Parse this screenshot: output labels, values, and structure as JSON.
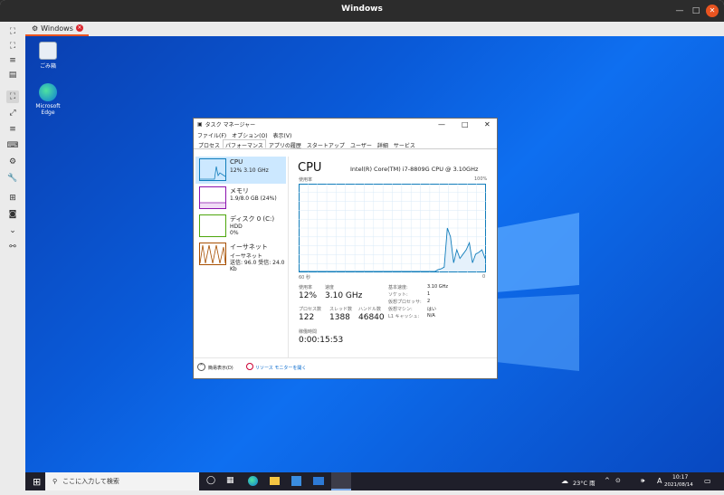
{
  "window": {
    "title": "Windows"
  },
  "tab": {
    "label": "Windows"
  },
  "desktop": {
    "icons": [
      {
        "label": "ごみ箱"
      },
      {
        "label": "Microsoft Edge"
      }
    ]
  },
  "taskmgr": {
    "title": "タスク マネージャー",
    "menus": [
      "ファイル(F)",
      "オプション(O)",
      "表示(V)"
    ],
    "tabs": [
      "プロセス",
      "パフォーマンス",
      "アプリの履歴",
      "スタートアップ",
      "ユーザー",
      "詳細",
      "サービス"
    ],
    "resources": [
      {
        "name": "CPU",
        "sub": "12%  3.10 GHz",
        "sub2": ""
      },
      {
        "name": "メモリ",
        "sub": "1.9/8.0 GB (24%)",
        "sub2": ""
      },
      {
        "name": "ディスク 0 (C:)",
        "sub": "HDD",
        "sub2": "0%"
      },
      {
        "name": "イーサネット",
        "sub": "イーサネット",
        "sub2": "送信: 96.0  受信: 24.0 Kb"
      }
    ],
    "cpu": {
      "heading": "CPU",
      "model": "Intel(R) Core(TM) i7-8809G CPU @ 3.10GHz",
      "graph_label": "使用率",
      "graph_max": "100%",
      "graph_time": "60 秒",
      "graph_zero": "0",
      "usage_label": "使用率",
      "usage": "12%",
      "speed_label": "速度",
      "speed": "3.10 GHz",
      "proc_label": "プロセス数",
      "proc": "122",
      "thread_label": "スレッド数",
      "thread": "1388",
      "handle_label": "ハンドル数",
      "handle": "46840",
      "uptime_label": "稼働時間",
      "uptime": "0:00:15:53",
      "details": [
        [
          "基本速度:",
          "3.10 GHz"
        ],
        [
          "ソケット:",
          "1"
        ],
        [
          "仮想プロセッサ:",
          "2"
        ],
        [
          "仮想マシン:",
          "はい"
        ],
        [
          "L1 キャッシュ:",
          "N/A"
        ]
      ]
    },
    "footer": {
      "fewer": "簡易表示(D)",
      "monitor": "リソース モニターを開く"
    }
  },
  "taskbar": {
    "search": "ここに入力して検索",
    "weather": "23°C 雨",
    "ime": "A",
    "time": "10:17",
    "date": "2021/08/14"
  },
  "colors": {
    "accent": "#e95420",
    "cpu": "#117dbb",
    "memory": "#8b12ae",
    "disk": "#4da60c",
    "net": "#a74f01"
  },
  "chart_data": {
    "type": "area",
    "title": "使用率",
    "ylim": [
      0,
      100
    ],
    "x_label": "60 秒",
    "values": [
      0,
      0,
      0,
      0,
      0,
      0,
      0,
      0,
      0,
      0,
      0,
      0,
      0,
      0,
      0,
      0,
      0,
      0,
      0,
      0,
      0,
      0,
      0,
      0,
      0,
      0,
      0,
      0,
      0,
      0,
      0,
      0,
      0,
      0,
      0,
      0,
      0,
      0,
      0,
      0,
      0,
      0,
      0,
      0,
      2,
      3,
      5,
      50,
      40,
      10,
      25,
      15,
      20,
      25,
      33,
      10,
      20,
      22,
      25,
      15
    ]
  }
}
